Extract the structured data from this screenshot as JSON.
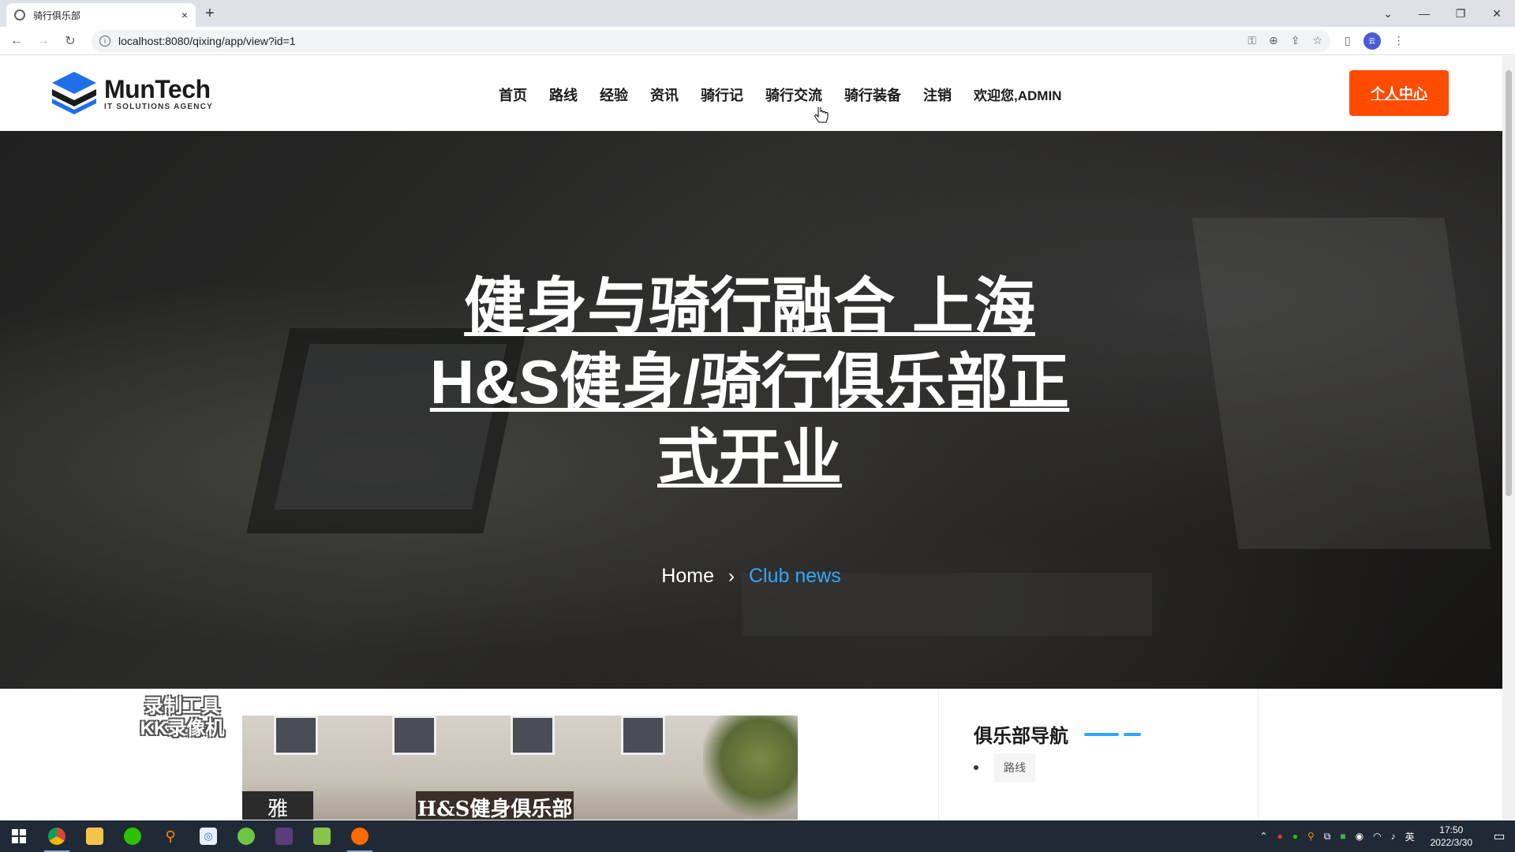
{
  "browser": {
    "tab_title": "骑行俱乐部",
    "tab_close": "×",
    "new_tab": "+",
    "url": "localhost:8080/qixing/app/view?id=1",
    "window_controls": [
      "⌄",
      "—",
      "❐",
      "✕"
    ]
  },
  "site": {
    "logo_name": "MunTech",
    "logo_tagline": "IT SOLUTIONS AGENCY",
    "nav": [
      {
        "label": "首页"
      },
      {
        "label": "路线"
      },
      {
        "label": "经验"
      },
      {
        "label": "资讯"
      },
      {
        "label": "骑行记"
      },
      {
        "label": "骑行交流"
      },
      {
        "label": "骑行装备"
      },
      {
        "label": "注销"
      },
      {
        "label": "欢迎您,ADMIN"
      }
    ],
    "cta_label": "个人中心",
    "brand_color": "#ff4c00",
    "accent_color": "#2fa7ff"
  },
  "hero": {
    "title": "健身与骑行融合 上海H&S健身/骑行俱乐部正式开业",
    "breadcrumb_home": "Home",
    "breadcrumb_sep": "›",
    "breadcrumb_current": "Club news"
  },
  "content": {
    "watermark_line1": "录制工具",
    "watermark_line2": "KK录像机",
    "image_sign_main": "H&S健身俱乐部",
    "image_sign_left": "雅",
    "sidebar_title": "俱乐部导航",
    "sidebar_items": [
      {
        "label": "路线"
      }
    ]
  },
  "taskbar": {
    "time": "17:50",
    "date": "2022/3/30",
    "ime": "英"
  }
}
